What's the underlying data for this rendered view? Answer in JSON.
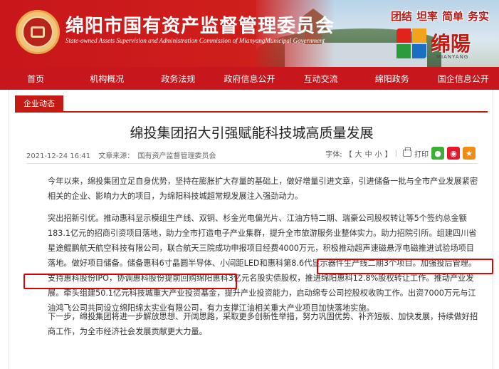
{
  "header": {
    "site_title": "绵阳市国有资产监督管理委员会",
    "site_subtitle": "State-owned Assets Supervision and Administration Commission of MianyangMunicipal Government",
    "slogans": [
      "团结",
      "坦率",
      "简单",
      "务实"
    ],
    "city_logo_text": "绵陽",
    "city_logo_en": "MIANYANG"
  },
  "nav": {
    "items": [
      "首页",
      "机构概况",
      "政务法规",
      "政府信息公开",
      "互动交流",
      "绵阳政务",
      "国企信息公开"
    ]
  },
  "section": {
    "tab_label": "企业动态"
  },
  "article": {
    "title": "绵投集团招大引强赋能科技城高质量发展",
    "date": "2021-12-24 16:41",
    "source": "文章来源：",
    "publisher": "国有资产监督管理委员会",
    "font_label": "字体:",
    "font_open": "【",
    "font_large": "大",
    "font_medium": "中",
    "font_small": "小",
    "font_close": "】",
    "print_label": "打印",
    "share_icons": [
      "wechat-icon",
      "weibo-icon",
      "favorite-icon"
    ],
    "p1": "今年以来，绵投集团立足自身优势，坚持在膨胀扩大存量的基础上，做好增量引进文章，引进储备一批与全市产业发展紧密相关的企业、影响力大的项目，为绵阳科技城超常规发展注入强劲动力。",
    "p2": "突出招新引优。推动惠科显示模组生产线、双铜、杉金光电偏光片、江油方特二期、瑞豪公司股权转让等5个签约总金额183.1亿元的招商引资项目落地，助力全市打造电子产业集群，提升全市旅游服务业整体实力。助力招院引所。组建四川省星途鲲鹏航天航空科技有限公司，联合航天三院成功申报项目经费4000万元，积极推动超声速磁悬浮电磁推进试验场项目落地。做好项目储备。储备惠科6寸晶圆半导体、小间距LED和惠科第8.6代显示器件生产线二期3个项目。加强投后管理。支持惠科股份IPO，协调惠科股份提前回购绵阳惠科3亿元名股实债股权，推进绵阳惠科12.8%股权转让工作。推动产业发展。牵头组建50.1亿元科技城重大产业投资基金，提升产业投资能力，启动绵专公司控股权收购工作。出资7000万元与江油鸿飞公司共同设立绵阳绵太实业有限公司，有力支撑江油相关重大产业项目加快落地实施。",
    "p3": "下一步，绵投集团将进一步解放思想、开阔思路，采取更多创新性举措，努力巩固优势、补齐短板、加快发展，持续做好招商工作，为全市经济社会发展贡献更大力量。"
  },
  "colors": {
    "brand_red": "#c8161d",
    "highlight_red": "#e10000"
  }
}
